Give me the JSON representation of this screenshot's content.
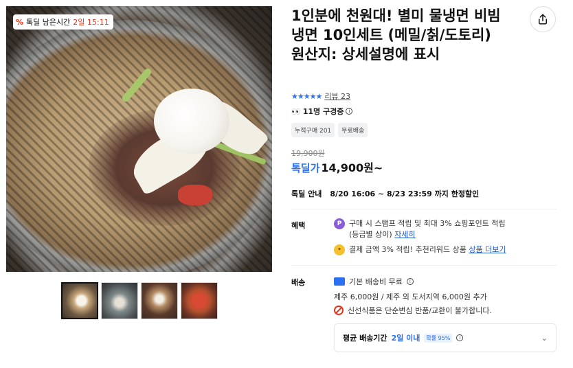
{
  "badge": {
    "icon": "percent-icon",
    "label": "톡딜 남은시간",
    "remaining": "2일 15:11"
  },
  "thumbnails": [
    {
      "alt": "thumb-1",
      "active": true
    },
    {
      "alt": "thumb-2",
      "active": false
    },
    {
      "alt": "thumb-3",
      "active": false
    },
    {
      "alt": "thumb-4",
      "active": false
    }
  ],
  "product": {
    "title": "1인분에 천원대! 별미 물냉면 비빔냉면 10인세트 (메밀/칡/도토리)\n원산지: 상세설명에 표시",
    "rating_stars": "★★★★★",
    "review_link": "리뷰 23",
    "viewers": "11명 구경중",
    "tags": [
      "누적구매 201",
      "무료배송"
    ],
    "original_price": "19,900원",
    "price_label": "톡딜가",
    "price_value": "14,900원~",
    "deal_label": "톡딜 안내",
    "deal_period": "8/20 16:06 ~ 8/23 23:59 까지 한정할인"
  },
  "benefits": {
    "label": "혜택",
    "items": [
      {
        "coin": "P",
        "text": "구매 시 스탬프 적립 및 최대 3% 쇼핑포인트 적립\n(등급별 상이) ",
        "link": "자세히"
      },
      {
        "coin": "•",
        "text": "결제 금액 3% 적립! 추천리워드 상품 ",
        "link": "상품 더보기"
      }
    ]
  },
  "shipping": {
    "label": "배송",
    "base": "기본 배송비 무료",
    "jeju": "제주 6,000원 / 제주 외 도서지역 6,000원 추가",
    "notice": "신선식품은 단순변심 반품/교환이 불가합니다.",
    "avg_label": "평균 배송기간",
    "avg_days": "2일 이내",
    "avg_prob": "확률 95%"
  },
  "colors": {
    "accent": "#2b70f0",
    "alert": "#e5361d",
    "link": "#1c55c9"
  }
}
